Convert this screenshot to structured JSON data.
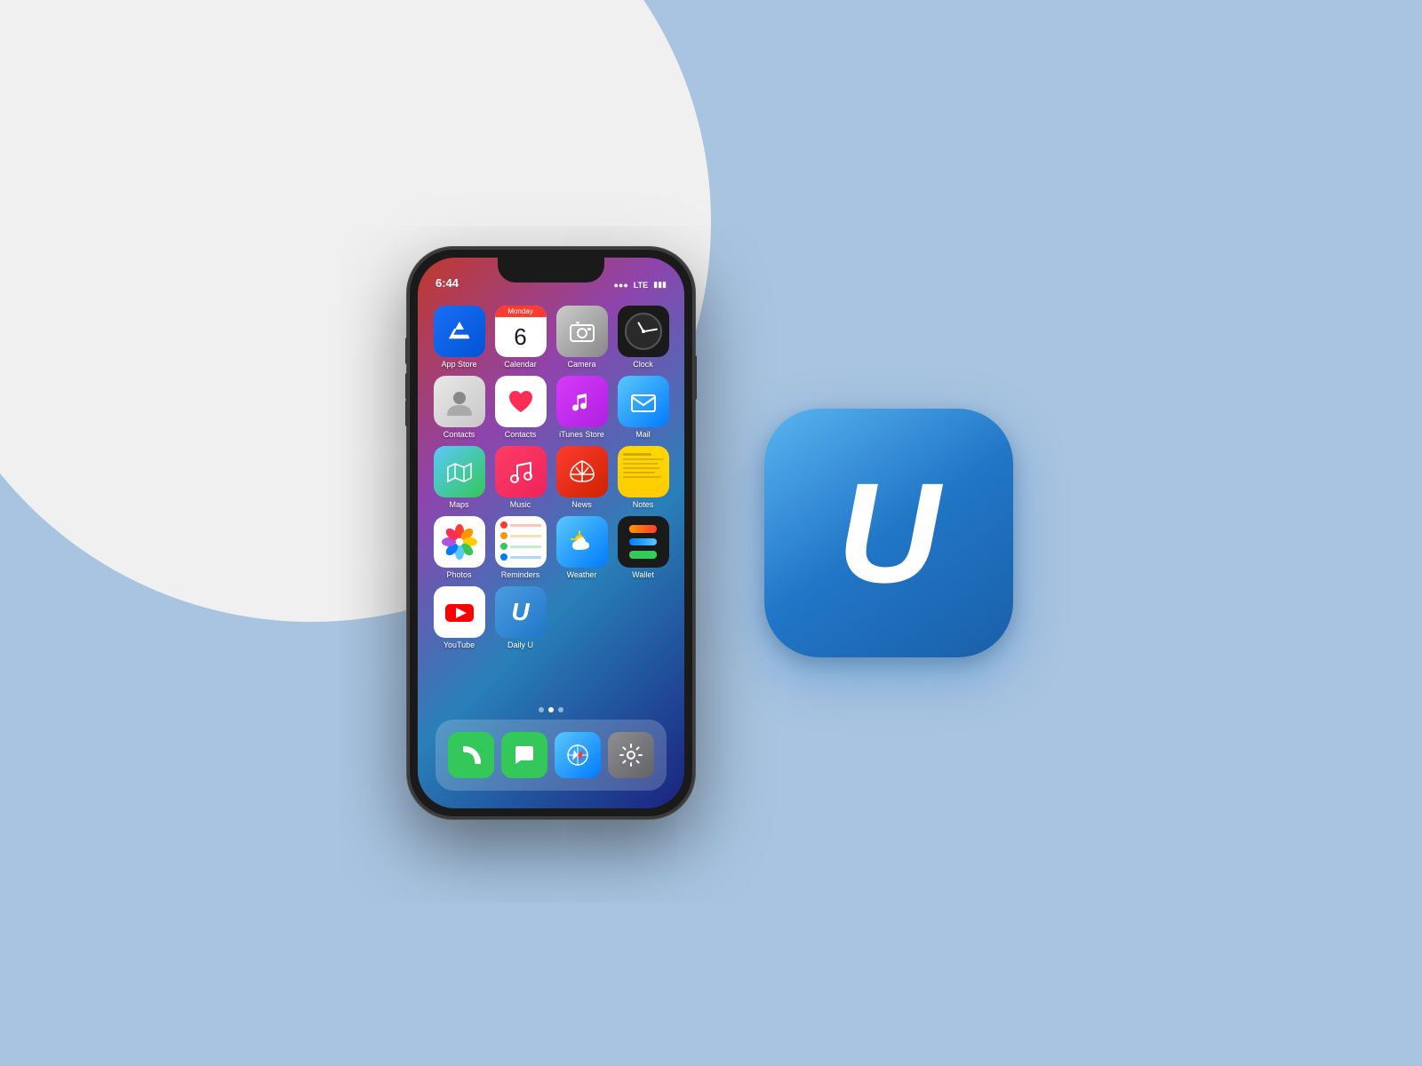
{
  "background": {
    "color": "#a8c4e0"
  },
  "phone": {
    "time": "6:44",
    "signal": "●●●",
    "network": "LTE",
    "battery": "▮▮▮",
    "apps": [
      {
        "id": "app-store",
        "label": "App Store",
        "row": 0,
        "col": 0
      },
      {
        "id": "calendar",
        "label": "Calendar",
        "row": 0,
        "col": 1,
        "day": "Monday",
        "date": "6"
      },
      {
        "id": "camera",
        "label": "Camera",
        "row": 0,
        "col": 2
      },
      {
        "id": "clock",
        "label": "Clock",
        "row": 0,
        "col": 3
      },
      {
        "id": "contacts",
        "label": "Contacts",
        "row": 1,
        "col": 0
      },
      {
        "id": "health",
        "label": "Health",
        "row": 1,
        "col": 1
      },
      {
        "id": "itunes-store",
        "label": "iTunes Store",
        "row": 1,
        "col": 2
      },
      {
        "id": "mail",
        "label": "Mail",
        "row": 1,
        "col": 3
      },
      {
        "id": "maps",
        "label": "Maps",
        "row": 2,
        "col": 0
      },
      {
        "id": "music",
        "label": "Music",
        "row": 2,
        "col": 1
      },
      {
        "id": "news",
        "label": "News",
        "row": 2,
        "col": 2
      },
      {
        "id": "notes",
        "label": "Notes",
        "row": 2,
        "col": 3
      },
      {
        "id": "photos",
        "label": "Photos",
        "row": 3,
        "col": 0
      },
      {
        "id": "reminders",
        "label": "Reminders",
        "row": 3,
        "col": 1
      },
      {
        "id": "weather",
        "label": "Weather",
        "row": 3,
        "col": 2
      },
      {
        "id": "wallet",
        "label": "Wallet",
        "row": 3,
        "col": 3
      },
      {
        "id": "youtube",
        "label": "YouTube",
        "row": 4,
        "col": 0
      },
      {
        "id": "daily-u",
        "label": "Daily U",
        "row": 4,
        "col": 1
      }
    ],
    "dock": [
      {
        "id": "phone",
        "label": "Phone"
      },
      {
        "id": "messages",
        "label": "Messages"
      },
      {
        "id": "safari",
        "label": "Safari"
      },
      {
        "id": "settings",
        "label": "Settings"
      }
    ],
    "calendar_day": "Monday",
    "calendar_date": "6"
  },
  "u_icon": {
    "letter": "U",
    "gradient_start": "#5ab4f0",
    "gradient_end": "#1a5fa8"
  }
}
